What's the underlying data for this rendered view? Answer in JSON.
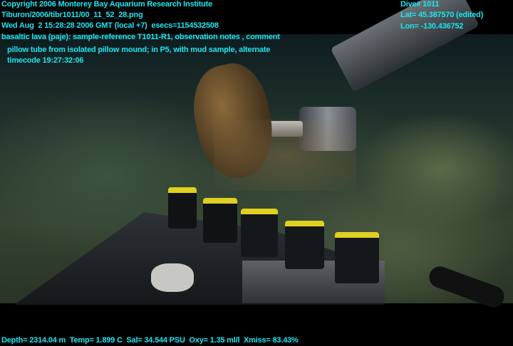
{
  "overlay_top_left": {
    "copyright": "Copyright 2006 Monterey Bay Aquarium Research Institute",
    "file": "Tiburon/2006/tibr1011/00_11_52_28.png",
    "datetime": "Wed Aug  2 15:28:28 2006 GMT (local +7)  esecs=1154532508",
    "annotation_line1": "basaltic lava (paje): sample-reference T1011-R1, observation notes , comment",
    "annotation_line2": "pillow tube from isolated pillow mound; in P5, with mud sample, alternate",
    "annotation_line3": "timecode 19:27:32:06"
  },
  "overlay_top_right": {
    "dive": "Dive# 1011",
    "lat": "Lat= 45.387570 (edited)",
    "lon": "Lon= -130.436752"
  },
  "overlay_bottom": {
    "sensors": "Depth= 2314.04 m  Temp= 1.899 C  Sal= 34.544 PSU  Oxy= 1.35 ml/l  Xmiss= 83.43%"
  },
  "colors": {
    "overlay_text": "#1ee6f0"
  }
}
